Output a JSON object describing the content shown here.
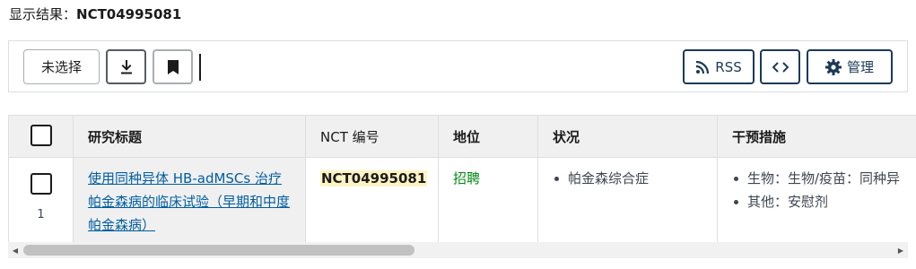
{
  "results": {
    "label": "显示结果：",
    "value": "NCT04995081"
  },
  "toolbar": {
    "unselect_label": "未选择",
    "download_icon": "download-icon",
    "bookmark_icon": "bookmark-icon",
    "rss_label": "RSS",
    "rss_icon": "rss-icon",
    "embed_icon": "code-brackets-icon",
    "manage_label": "管理",
    "manage_icon": "gear-icon"
  },
  "table": {
    "headers": {
      "title": "研究标题",
      "nct": "NCT 编号",
      "status": "地位",
      "conditions": "状况",
      "interventions": "干预措施"
    },
    "rows": [
      {
        "number": "1",
        "title": "使用同种异体 HB-adMSCs 治疗帕金森病的临床试验（早期和中度帕金森病）",
        "nct": "NCT04995081",
        "status": "招聘",
        "conditions": [
          "帕金森综合症"
        ],
        "interventions": [
          "生物：生物/疫苗：同种异",
          "其他：安慰剂"
        ]
      }
    ]
  },
  "colors": {
    "link": "#005ea2",
    "status_recruiting": "#008817",
    "highlight": "#fff3c4",
    "header_bg": "#f0f0f0",
    "button_dark": "#1b3a57"
  }
}
